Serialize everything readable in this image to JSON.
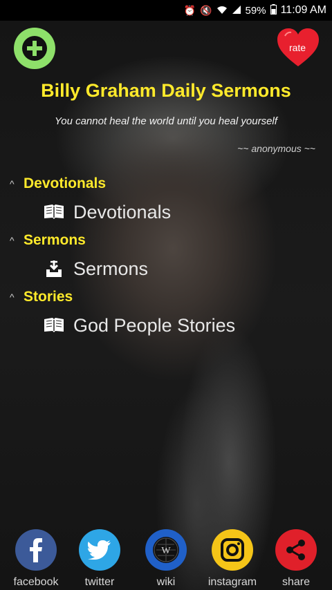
{
  "status_bar": {
    "icons": [
      "alarm-icon",
      "mute-icon",
      "wifi-icon",
      "signal-icon"
    ],
    "battery": "59%",
    "time": "11:09 AM"
  },
  "header": {
    "add_icon": "plus-icon",
    "rate_label": "rate",
    "title": "Billy Graham Daily Sermons",
    "quote": "You cannot heal the world until you heal yourself",
    "author": "~~ anonymous ~~"
  },
  "sections": [
    {
      "title": "Devotionals",
      "items": [
        {
          "label": "Devotionals",
          "icon": "book-icon"
        }
      ]
    },
    {
      "title": "Sermons",
      "items": [
        {
          "label": "Sermons",
          "icon": "download-tray-icon"
        }
      ]
    },
    {
      "title": "Stories",
      "items": [
        {
          "label": "God People Stories",
          "icon": "book-icon"
        }
      ]
    }
  ],
  "social": [
    {
      "label": "facebook",
      "icon": "facebook-icon"
    },
    {
      "label": "twitter",
      "icon": "twitter-icon"
    },
    {
      "label": "wiki",
      "icon": "wikipedia-icon"
    },
    {
      "label": "instagram",
      "icon": "instagram-icon"
    },
    {
      "label": "share",
      "icon": "share-icon"
    }
  ],
  "colors": {
    "title_yellow": "#ffea2b",
    "add_green": "#8ee06a",
    "rate_red": "#e8202e"
  }
}
